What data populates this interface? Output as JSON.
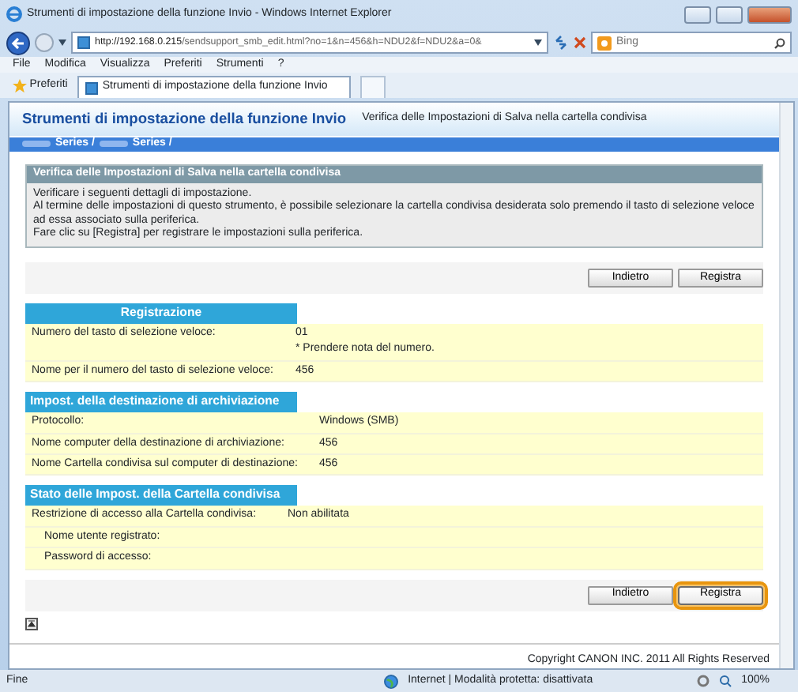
{
  "window": {
    "title": "Strumenti di impostazione della funzione Invio - Windows Internet Explorer"
  },
  "address_bar": {
    "url_host": "http://192.168.0.215",
    "url_path": "/sendsupport_smb_edit.html?no=1&n=456&h=NDU2&f=NDU2&a=0&"
  },
  "search": {
    "placeholder": "Bing"
  },
  "menu": [
    "File",
    "Modifica",
    "Visualizza",
    "Preferiti",
    "Strumenti",
    "?"
  ],
  "favorites": {
    "label": "Preferiti"
  },
  "tabs": [
    {
      "label": "Strumenti di impostazione della funzione Invio",
      "selected": true
    }
  ],
  "page": {
    "title": "Strumenti di impostazione della funzione Invio",
    "subtitle": "Verifica delle Impostazioni di Salva nella cartella condivisa",
    "breadcrumb": [
      "Series /",
      "Series /"
    ],
    "notice": {
      "title": "Verifica delle Impostazioni di Salva nella cartella condivisa",
      "lines": [
        "Verificare i seguenti dettagli di impostazione.",
        "Al termine delle impostazioni di questo strumento, è possibile selezionare la cartella condivisa desiderata solo premendo il tasto di selezione veloce ad essa associato sulla periferica.",
        "Fare clic su [Registra] per registrare le impostazioni sulla periferica."
      ]
    },
    "top_buttons": [
      {
        "label": "Indietro",
        "focused": false
      },
      {
        "label": "Registra",
        "focused": false
      }
    ],
    "sections": [
      {
        "title": "Registrazione",
        "centered": true,
        "rows": [
          {
            "label": "Numero del tasto di selezione veloce:",
            "value": "01",
            "note": "* Prendere nota del numero."
          },
          {
            "label": "Nome per il numero del tasto di selezione veloce:",
            "value": "456"
          }
        ]
      },
      {
        "title": "Impost. della destinazione di archiviazione",
        "centered": false,
        "rows": [
          {
            "label": "Protocollo:",
            "value": "Windows (SMB)"
          },
          {
            "label": "Nome computer della destinazione di archiviazione:",
            "value": "456"
          },
          {
            "label": "Nome Cartella condivisa sul computer di destinazione:",
            "value": "456"
          }
        ]
      },
      {
        "title": "Stato delle Impost. della Cartella condivisa",
        "centered": false,
        "rows": [
          {
            "label": "Restrizione di accesso alla Cartella condivisa:",
            "value": "Non abilitata",
            "children": [
              {
                "label": "Nome utente registrato:"
              },
              {
                "label": "Password di accesso:"
              }
            ]
          }
        ]
      }
    ],
    "bottom_buttons": [
      {
        "label": "Indietro",
        "focused": false
      },
      {
        "label": "Registra",
        "focused": true
      }
    ],
    "copyright": "Copyright CANON INC. 2011 All Rights Reserved"
  },
  "status_bar": {
    "text": "Fine",
    "zone": "Internet | Modalità protetta: disattivata",
    "zoom": "100%"
  }
}
